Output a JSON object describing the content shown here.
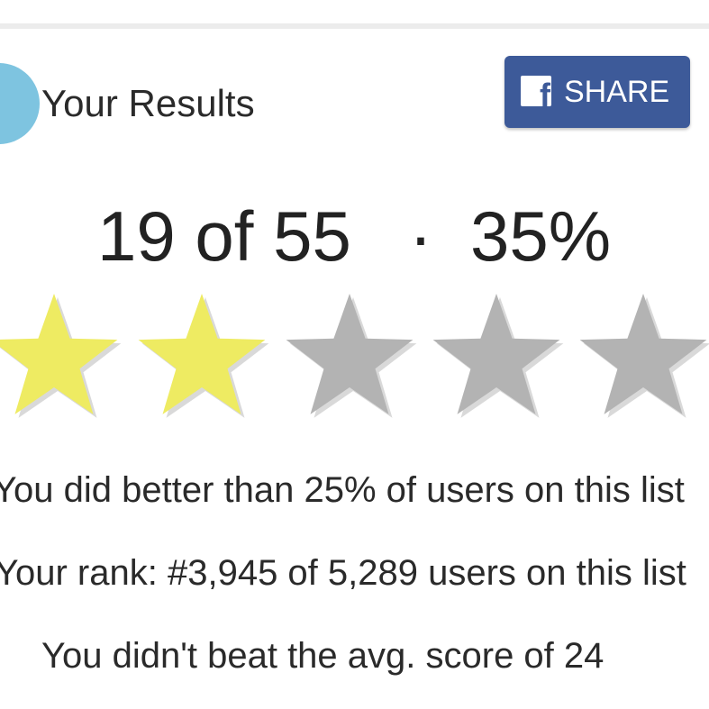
{
  "header": {
    "title": "Your Results",
    "share_label": "SHARE",
    "share_icon": "facebook-icon",
    "share_color": "#3d5a99",
    "avatar_color": "#7ec4e0"
  },
  "score": {
    "count_text": "19 of 55",
    "separator": "·",
    "percent_text": "35%",
    "rating": {
      "filled_stars": 2,
      "total_stars": 5,
      "filled_color": "#eeeb62",
      "empty_color": "#b3b3b3"
    }
  },
  "stats": {
    "better_than": "You did better than 25% of users on this list",
    "rank": "Your rank: #3,945 of 5,289 users on this list",
    "average": "You didn't beat the avg. score of 24"
  }
}
